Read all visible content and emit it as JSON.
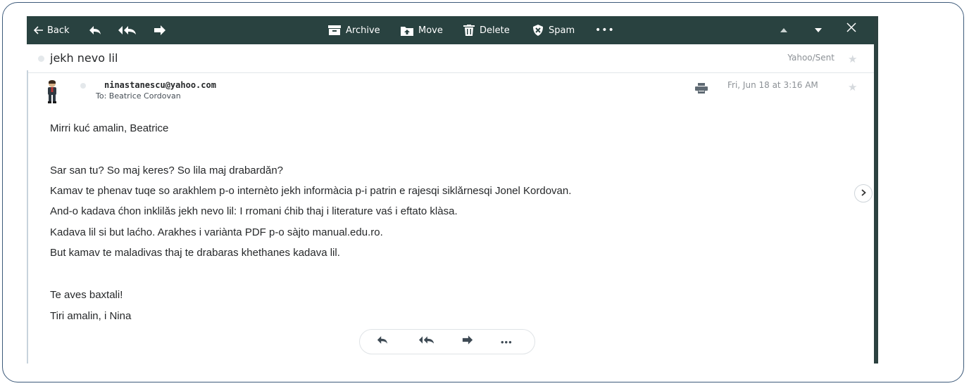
{
  "toolbar": {
    "back_label": "Back",
    "archive_label": "Archive",
    "move_label": "Move",
    "delete_label": "Delete",
    "spam_label": "Spam",
    "more_label": "•••",
    "icons": [
      "back-arrow-icon",
      "reply-icon",
      "reply-all-icon",
      "forward-icon",
      "archive-icon",
      "move-icon",
      "delete-icon",
      "spam-icon",
      "more-icon",
      "previous-icon",
      "next-icon",
      "close-icon"
    ]
  },
  "message": {
    "subject": "jekh nevo lil",
    "folder": "Yahoo/Sent",
    "sender_email": "ninastanescu@yahoo.com",
    "to_line": "To: Beatrice Cordovan",
    "date": "Fri, Jun 18 at 3:16 AM",
    "body": {
      "greeting": "Mirri kuć amalin, Beatrice",
      "line1": "Sar san tu? So maj keres? So lila maj drabardǎn?",
      "line2": "Kamav te phenav tuqe so arakhlem p-o internèto jekh informàcia p-i patrin e rajesqi siklǎrnesqi Jonel Kordovan.",
      "line3": "And-o kadava ćhon inklilǎs jekh nevo lil: I rromani ćhib thaj i literature vaś i eftato klàsa.",
      "line4": "Kadava lil si but laćho. Arakhes i variànta PDF p-o sàjto manual.edu.ro.",
      "line5": "But kamav te maladivas thaj te drabaras khethanes kadava lil.",
      "closing1": "Te aves baxtali!",
      "closing2": "Tiri amalin, i Nina"
    }
  },
  "colors": {
    "toolbar_bg": "#294240",
    "frame": "#3d5a7a",
    "text": "#26282a",
    "muted": "#8c9196"
  }
}
